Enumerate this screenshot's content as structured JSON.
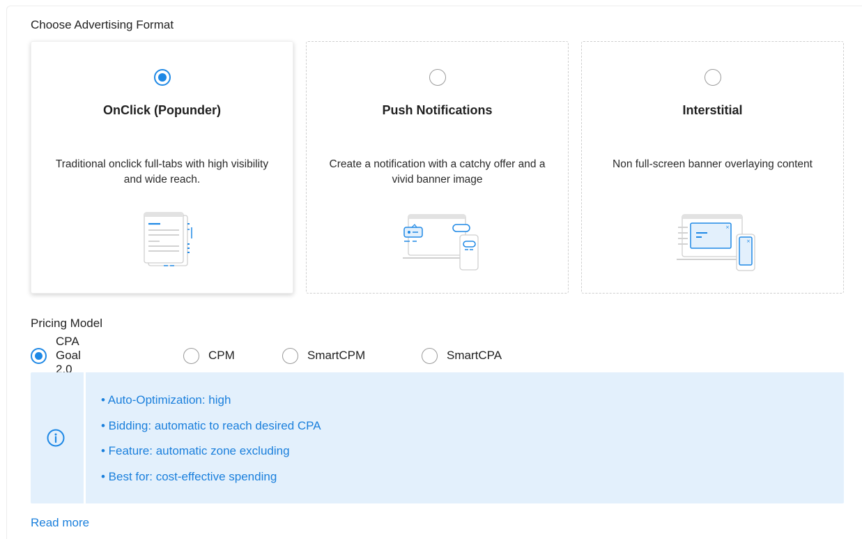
{
  "format_section": {
    "title": "Choose Advertising Format",
    "cards": [
      {
        "name": "OnClick (Popunder)",
        "description": "Traditional onclick full-tabs with high visibility and wide reach.",
        "selected": true
      },
      {
        "name": "Push Notifications",
        "description": "Create a notification with a catchy offer and a vivid banner image",
        "selected": false
      },
      {
        "name": "Interstitial",
        "description": "Non full-screen banner overlaying content",
        "selected": false
      }
    ]
  },
  "pricing_section": {
    "title": "Pricing Model",
    "options": [
      {
        "label": "CPA Goal 2.0",
        "selected": true
      },
      {
        "label": "CPM",
        "selected": false
      },
      {
        "label": "SmartCPM",
        "selected": false
      },
      {
        "label": "SmartCPA",
        "selected": false
      }
    ],
    "info": {
      "icon": "info-icon",
      "items": [
        "• Auto-Optimization: high",
        "• Bidding: automatic to reach desired CPA",
        "• Feature: automatic zone excluding",
        "• Best for: cost-effective spending"
      ]
    },
    "read_more": "Read more"
  },
  "colors": {
    "accent": "#1e88e5",
    "link": "#1a7fdc",
    "info_bg": "#e3f0fc"
  }
}
